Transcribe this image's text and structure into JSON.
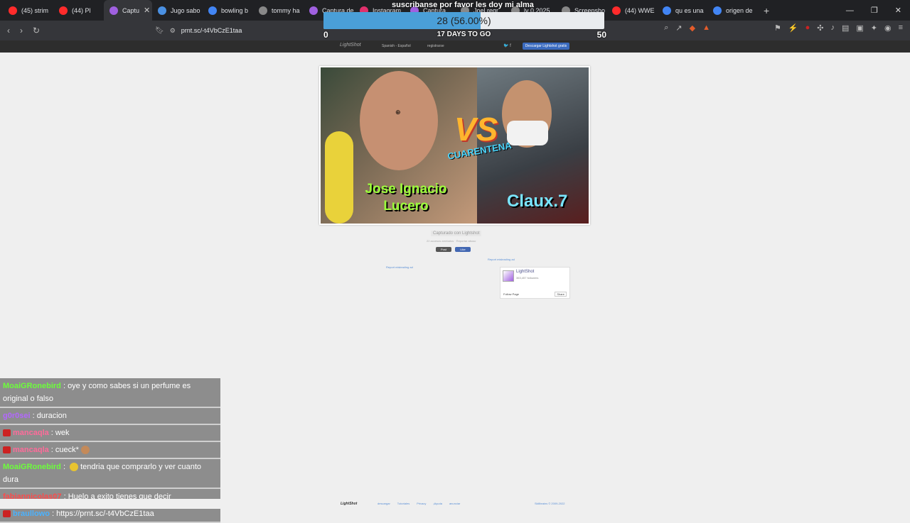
{
  "browser": {
    "tabs": [
      {
        "label": "(45) strim",
        "color": "#ff2b2b"
      },
      {
        "label": "(44) Pl",
        "color": "#ff2b2b"
      },
      {
        "label": "Captu",
        "color": "#a060e0",
        "active": true
      },
      {
        "label": "Jugo sabo",
        "color": "#4a90e2"
      },
      {
        "label": "bowling b",
        "color": "#4285f4"
      },
      {
        "label": "tommy ha",
        "color": "#888888"
      },
      {
        "label": "Captura de",
        "color": "#a060e0"
      },
      {
        "label": "Instagram",
        "color": "#e1306c"
      },
      {
        "label": "Captura",
        "color": "#a060e0"
      },
      {
        "label": "Joel regr",
        "color": "#888888"
      },
      {
        "label": "lv 0 2025",
        "color": "#888888"
      },
      {
        "label": "Screensho",
        "color": "#888888"
      },
      {
        "label": "(44) WWE",
        "color": "#ff2b2b"
      },
      {
        "label": "qu es una",
        "color": "#4285f4"
      },
      {
        "label": "origen de",
        "color": "#4285f4"
      }
    ],
    "new_tab": "+",
    "url": "prnt.sc/-t4VbCzE1taa"
  },
  "goal": {
    "title": "suscribanse por favor les doy mi alma",
    "text": "28 (56.00%)",
    "progress_pct": 56,
    "days": "17 DAYS TO GO",
    "min": "0",
    "max": "50"
  },
  "lightshot": {
    "logo": "LightShot",
    "language": "Spanish - Español",
    "register": "registrarse",
    "social": "🐦 f",
    "download": "Descargar Lightshot gratis",
    "thumbnail": {
      "vs": "VS",
      "cuarentena": "CUARENTENA",
      "name_left": "Jose Ignacio Lucero",
      "name_right": "Claux.7"
    },
    "caption": "Capturado con Lightshot",
    "caption_line": "22 accesos arrebatos · Reportar abuso",
    "post": "Post",
    "like": "Like",
    "report1": "Report misleading ad",
    "report2": "Report misleading ad",
    "fb": {
      "title": "LightShot",
      "subtitle": "363,457 followers",
      "follow": "Follow Page",
      "share": "Share"
    },
    "footer": {
      "logo": "LightShot",
      "links": [
        "descargar",
        "Tutoriales",
        "Privacy",
        "¡Ayuda",
        "anunciar"
      ],
      "copy": "Skillbrains © 2009-2022"
    }
  },
  "chat": {
    "messages": [
      {
        "user": "MoaiGRonebird",
        "color": "#6cff3a",
        "text": "oye y como sabes si un perfume es original o falso"
      },
      {
        "user": "g0r0sei",
        "color": "#b366ff",
        "text": "duracion"
      },
      {
        "user": "mancaqla",
        "color": "#ff6b9a",
        "text": "wek",
        "badge": true
      },
      {
        "user": "mancaqla",
        "color": "#ff6b9a",
        "text": "cueck*",
        "badge": true,
        "emote_after": true
      },
      {
        "user": "MoaiGRonebird",
        "color": "#6cff3a",
        "text": "tendria que comprarlo y ver cuanto dura",
        "emote_before": true
      },
      {
        "user": "fabiannicolas07",
        "color": "#ff4a4a",
        "text": "Huelo a exito tienes que decir"
      },
      {
        "user": "braullowo",
        "color": "#4ab2ff",
        "text": "https://prnt.sc/-t4VbCzE1taa",
        "badge": true
      }
    ]
  }
}
